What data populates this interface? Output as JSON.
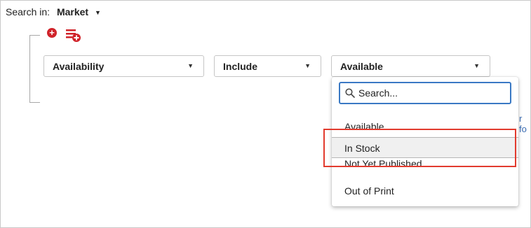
{
  "header": {
    "search_in_label": "Search in:",
    "scope_value": "Market",
    "caret": "▼"
  },
  "toolbar": {
    "add_condition_symbol": "+"
  },
  "filters": {
    "field_value": "Availability",
    "operator_value": "Include",
    "value_value": "Available",
    "caret": "▼"
  },
  "side_link_text": "r fo",
  "dropdown": {
    "search_placeholder": "Search...",
    "options": [
      {
        "label": "Available"
      },
      {
        "label": "In Stock"
      },
      {
        "label": "Not Yet Published"
      },
      {
        "label": "Out of Print"
      }
    ],
    "hovered_option": "In Stock"
  },
  "colors": {
    "accent": "#3a79c4",
    "add_icon": "#d0232a",
    "highlight": "#e23b2e"
  }
}
